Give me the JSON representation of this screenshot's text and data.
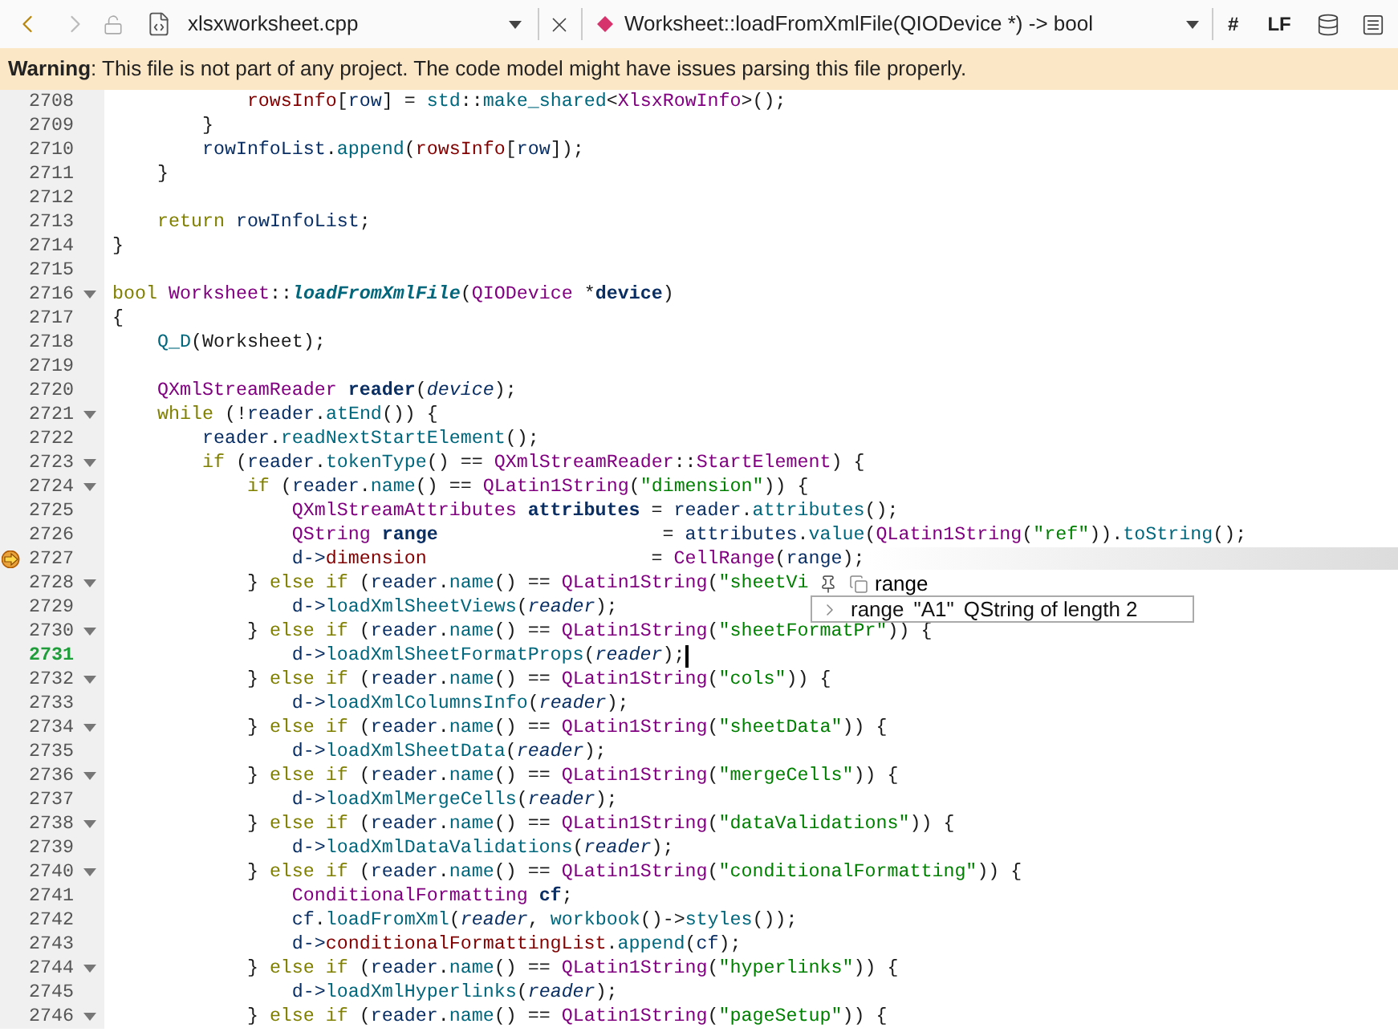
{
  "toolbar": {
    "forward_disabled": true,
    "file_name": "xlsxworksheet.cpp",
    "symbol": "Worksheet::loadFromXmlFile(QIODevice *) -> bool",
    "indent_mark": "#",
    "line_ending": "LF"
  },
  "warning": "**Warning**: This file is not part of any project. The code model might have issues parsing this file properly.",
  "lines": [
    {
      "number": "2708",
      "fold": false,
      "current": false,
      "execution": false,
      "tokens": [
        {
          "kind": "mem",
          "text": "            rowsInfo"
        },
        {
          "kind": "p",
          "text": "["
        },
        {
          "kind": "ns",
          "text": "row"
        },
        {
          "kind": "p",
          "text": "] = "
        },
        {
          "kind": "fn",
          "text": "std"
        },
        {
          "kind": "p",
          "text": "::"
        },
        {
          "kind": "fn",
          "text": "make_shared"
        },
        {
          "kind": "p",
          "text": "<"
        },
        {
          "kind": "ty",
          "text": "XlsxRowInfo"
        },
        {
          "kind": "p",
          "text": ">();"
        }
      ]
    },
    {
      "number": "2709",
      "fold": false,
      "current": false,
      "execution": false,
      "tokens": [
        {
          "kind": "p",
          "text": "        }"
        }
      ]
    },
    {
      "number": "2710",
      "fold": false,
      "current": false,
      "execution": false,
      "tokens": [
        {
          "kind": "ns",
          "text": "        rowInfoList"
        },
        {
          "kind": "p",
          "text": "."
        },
        {
          "kind": "fn",
          "text": "append"
        },
        {
          "kind": "p",
          "text": "("
        },
        {
          "kind": "mem",
          "text": "rowsInfo"
        },
        {
          "kind": "p",
          "text": "["
        },
        {
          "kind": "ns",
          "text": "row"
        },
        {
          "kind": "p",
          "text": "]);"
        }
      ]
    },
    {
      "number": "2711",
      "fold": false,
      "current": false,
      "execution": false,
      "tokens": [
        {
          "kind": "p",
          "text": "    }"
        }
      ]
    },
    {
      "number": "2712",
      "fold": false,
      "current": false,
      "execution": false
    },
    {
      "number": "2713",
      "fold": false,
      "current": false,
      "execution": false,
      "tokens": [
        {
          "kind": "kw",
          "text": "    return "
        },
        {
          "kind": "ns",
          "text": "rowInfoList"
        },
        {
          "kind": "p",
          "text": ";"
        }
      ]
    },
    {
      "number": "2714",
      "fold": false,
      "current": false,
      "execution": false,
      "tokens": [
        {
          "kind": "p",
          "text": "}"
        }
      ]
    },
    {
      "number": "2715",
      "fold": false,
      "current": false,
      "execution": false
    },
    {
      "number": "2716",
      "fold": true,
      "current": false,
      "execution": false,
      "tokens": [
        {
          "kind": "kw",
          "text": "bool "
        },
        {
          "kind": "ty",
          "text": "Worksheet"
        },
        {
          "kind": "p",
          "text": "::"
        },
        {
          "kind": "fd",
          "text": "loadFromXmlFile"
        },
        {
          "kind": "p",
          "text": "("
        },
        {
          "kind": "ty",
          "text": "QIODevice"
        },
        {
          "kind": "p",
          "text": " *"
        },
        {
          "kind": "lv",
          "text": "device"
        },
        {
          "kind": "p",
          "text": ")"
        }
      ]
    },
    {
      "number": "2717",
      "fold": false,
      "current": false,
      "execution": false,
      "tokens": [
        {
          "kind": "p",
          "text": "{"
        }
      ]
    },
    {
      "number": "2718",
      "fold": false,
      "current": false,
      "execution": false,
      "tokens": [
        {
          "kind": "fn",
          "text": "    Q_D"
        },
        {
          "kind": "p",
          "text": "(Worksheet);"
        }
      ]
    },
    {
      "number": "2719",
      "fold": false,
      "current": false,
      "execution": false
    },
    {
      "number": "2720",
      "fold": false,
      "current": false,
      "execution": false,
      "tokens": [
        {
          "kind": "ty",
          "text": "    QXmlStreamReader "
        },
        {
          "kind": "lv",
          "text": "reader"
        },
        {
          "kind": "p",
          "text": "("
        },
        {
          "kind": "it",
          "text": "device"
        },
        {
          "kind": "p",
          "text": ");"
        }
      ]
    },
    {
      "number": "2721",
      "fold": true,
      "current": false,
      "execution": false,
      "tokens": [
        {
          "kind": "kw",
          "text": "    while"
        },
        {
          "kind": "p",
          "text": " (!"
        },
        {
          "kind": "ns",
          "text": "reader"
        },
        {
          "kind": "p",
          "text": "."
        },
        {
          "kind": "fn",
          "text": "atEnd"
        },
        {
          "kind": "p",
          "text": "()) {"
        }
      ]
    },
    {
      "number": "2722",
      "fold": false,
      "current": false,
      "execution": false,
      "tokens": [
        {
          "kind": "ns",
          "text": "        reader"
        },
        {
          "kind": "p",
          "text": "."
        },
        {
          "kind": "fn",
          "text": "readNextStartElement"
        },
        {
          "kind": "p",
          "text": "();"
        }
      ]
    },
    {
      "number": "2723",
      "fold": true,
      "current": false,
      "execution": false,
      "tokens": [
        {
          "kind": "kw",
          "text": "        if"
        },
        {
          "kind": "p",
          "text": " ("
        },
        {
          "kind": "ns",
          "text": "reader"
        },
        {
          "kind": "p",
          "text": "."
        },
        {
          "kind": "fn",
          "text": "tokenType"
        },
        {
          "kind": "p",
          "text": "() == "
        },
        {
          "kind": "ty",
          "text": "QXmlStreamReader"
        },
        {
          "kind": "p",
          "text": "::"
        },
        {
          "kind": "ty",
          "text": "StartElement"
        },
        {
          "kind": "p",
          "text": ") {"
        }
      ]
    },
    {
      "number": "2724",
      "fold": true,
      "current": false,
      "execution": false,
      "tokens": [
        {
          "kind": "kw",
          "text": "            if"
        },
        {
          "kind": "p",
          "text": " ("
        },
        {
          "kind": "ns",
          "text": "reader"
        },
        {
          "kind": "p",
          "text": "."
        },
        {
          "kind": "fn",
          "text": "name"
        },
        {
          "kind": "p",
          "text": "() == "
        },
        {
          "kind": "ty",
          "text": "QLatin1String"
        },
        {
          "kind": "p",
          "text": "("
        },
        {
          "kind": "s",
          "text": "\"dimension\""
        },
        {
          "kind": "p",
          "text": ")) {"
        }
      ]
    },
    {
      "number": "2725",
      "fold": false,
      "current": false,
      "execution": false,
      "tokens": [
        {
          "kind": "ty",
          "text": "                QXmlStreamAttributes "
        },
        {
          "kind": "lv",
          "text": "attributes"
        },
        {
          "kind": "p",
          "text": " = "
        },
        {
          "kind": "ns",
          "text": "reader"
        },
        {
          "kind": "p",
          "text": "."
        },
        {
          "kind": "fn",
          "text": "attributes"
        },
        {
          "kind": "p",
          "text": "();"
        }
      ]
    },
    {
      "number": "2726",
      "fold": false,
      "current": false,
      "execution": false,
      "tokens": [
        {
          "kind": "ty",
          "text": "                QString "
        },
        {
          "kind": "lv",
          "text": "range"
        },
        {
          "kind": "p",
          "text": "                    = "
        },
        {
          "kind": "ns",
          "text": "attributes"
        },
        {
          "kind": "p",
          "text": "."
        },
        {
          "kind": "fn",
          "text": "value"
        },
        {
          "kind": "p",
          "text": "("
        },
        {
          "kind": "ty",
          "text": "QLatin1String"
        },
        {
          "kind": "p",
          "text": "("
        },
        {
          "kind": "s",
          "text": "\"ref\""
        },
        {
          "kind": "p",
          "text": "))."
        },
        {
          "kind": "fn",
          "text": "toString"
        },
        {
          "kind": "p",
          "text": "();"
        }
      ]
    },
    {
      "number": "2727",
      "fold": false,
      "current": false,
      "execution": true,
      "tokens": [
        {
          "kind": "ns",
          "text": "                d->"
        },
        {
          "kind": "mem",
          "text": "dimension"
        },
        {
          "kind": "p",
          "text": "                    = "
        },
        {
          "kind": "ty",
          "text": "CellRange"
        },
        {
          "kind": "p",
          "text": "("
        },
        {
          "kind": "ns",
          "text": "range"
        },
        {
          "kind": "p",
          "text": ");"
        }
      ]
    },
    {
      "number": "2728",
      "fold": true,
      "current": false,
      "execution": false,
      "tokens": [
        {
          "kind": "p",
          "text": "            } "
        },
        {
          "kind": "kw",
          "text": "else if"
        },
        {
          "kind": "p",
          "text": " ("
        },
        {
          "kind": "ns",
          "text": "reader"
        },
        {
          "kind": "p",
          "text": "."
        },
        {
          "kind": "fn",
          "text": "name"
        },
        {
          "kind": "p",
          "text": "() == "
        },
        {
          "kind": "ty",
          "text": "QLatin1String"
        },
        {
          "kind": "p",
          "text": "("
        },
        {
          "kind": "s",
          "text": "\"sheetVi"
        }
      ]
    },
    {
      "number": "2729",
      "fold": false,
      "current": false,
      "execution": false,
      "tokens": [
        {
          "kind": "ns",
          "text": "                d->"
        },
        {
          "kind": "fn",
          "text": "loadXmlSheetViews"
        },
        {
          "kind": "p",
          "text": "("
        },
        {
          "kind": "it",
          "text": "reader"
        },
        {
          "kind": "p",
          "text": ");"
        }
      ]
    },
    {
      "number": "2730",
      "fold": true,
      "current": false,
      "execution": false,
      "tokens": [
        {
          "kind": "p",
          "text": "            } "
        },
        {
          "kind": "kw",
          "text": "else if"
        },
        {
          "kind": "p",
          "text": " ("
        },
        {
          "kind": "ns",
          "text": "reader"
        },
        {
          "kind": "p",
          "text": "."
        },
        {
          "kind": "fn",
          "text": "name"
        },
        {
          "kind": "p",
          "text": "() == "
        },
        {
          "kind": "ty",
          "text": "QLatin1String"
        },
        {
          "kind": "p",
          "text": "("
        },
        {
          "kind": "s",
          "text": "\"sheetFormatPr\""
        },
        {
          "kind": "p",
          "text": ")) {"
        }
      ]
    },
    {
      "number": "2731",
      "fold": false,
      "current": true,
      "execution": false,
      "tokens": [
        {
          "kind": "ns",
          "text": "                d->"
        },
        {
          "kind": "fn",
          "text": "loadXmlSheetFormatProps"
        },
        {
          "kind": "p",
          "text": "("
        },
        {
          "kind": "it",
          "text": "reader"
        },
        {
          "kind": "p",
          "text": ");"
        }
      ]
    },
    {
      "number": "2732",
      "fold": true,
      "current": false,
      "execution": false,
      "tokens": [
        {
          "kind": "p",
          "text": "            } "
        },
        {
          "kind": "kw",
          "text": "else if"
        },
        {
          "kind": "p",
          "text": " ("
        },
        {
          "kind": "ns",
          "text": "reader"
        },
        {
          "kind": "p",
          "text": "."
        },
        {
          "kind": "fn",
          "text": "name"
        },
        {
          "kind": "p",
          "text": "() == "
        },
        {
          "kind": "ty",
          "text": "QLatin1String"
        },
        {
          "kind": "p",
          "text": "("
        },
        {
          "kind": "s",
          "text": "\"cols\""
        },
        {
          "kind": "p",
          "text": ")) {"
        }
      ]
    },
    {
      "number": "2733",
      "fold": false,
      "current": false,
      "execution": false,
      "tokens": [
        {
          "kind": "ns",
          "text": "                d->"
        },
        {
          "kind": "fn",
          "text": "loadXmlColumnsInfo"
        },
        {
          "kind": "p",
          "text": "("
        },
        {
          "kind": "it",
          "text": "reader"
        },
        {
          "kind": "p",
          "text": ");"
        }
      ]
    },
    {
      "number": "2734",
      "fold": true,
      "current": false,
      "execution": false,
      "tokens": [
        {
          "kind": "p",
          "text": "            } "
        },
        {
          "kind": "kw",
          "text": "else if"
        },
        {
          "kind": "p",
          "text": " ("
        },
        {
          "kind": "ns",
          "text": "reader"
        },
        {
          "kind": "p",
          "text": "."
        },
        {
          "kind": "fn",
          "text": "name"
        },
        {
          "kind": "p",
          "text": "() == "
        },
        {
          "kind": "ty",
          "text": "QLatin1String"
        },
        {
          "kind": "p",
          "text": "("
        },
        {
          "kind": "s",
          "text": "\"sheetData\""
        },
        {
          "kind": "p",
          "text": ")) {"
        }
      ]
    },
    {
      "number": "2735",
      "fold": false,
      "current": false,
      "execution": false,
      "tokens": [
        {
          "kind": "ns",
          "text": "                d->"
        },
        {
          "kind": "fn",
          "text": "loadXmlSheetData"
        },
        {
          "kind": "p",
          "text": "("
        },
        {
          "kind": "it",
          "text": "reader"
        },
        {
          "kind": "p",
          "text": ");"
        }
      ]
    },
    {
      "number": "2736",
      "fold": true,
      "current": false,
      "execution": false,
      "tokens": [
        {
          "kind": "p",
          "text": "            } "
        },
        {
          "kind": "kw",
          "text": "else if"
        },
        {
          "kind": "p",
          "text": " ("
        },
        {
          "kind": "ns",
          "text": "reader"
        },
        {
          "kind": "p",
          "text": "."
        },
        {
          "kind": "fn",
          "text": "name"
        },
        {
          "kind": "p",
          "text": "() == "
        },
        {
          "kind": "ty",
          "text": "QLatin1String"
        },
        {
          "kind": "p",
          "text": "("
        },
        {
          "kind": "s",
          "text": "\"mergeCells\""
        },
        {
          "kind": "p",
          "text": ")) {"
        }
      ]
    },
    {
      "number": "2737",
      "fold": false,
      "current": false,
      "execution": false,
      "tokens": [
        {
          "kind": "ns",
          "text": "                d->"
        },
        {
          "kind": "fn",
          "text": "loadXmlMergeCells"
        },
        {
          "kind": "p",
          "text": "("
        },
        {
          "kind": "it",
          "text": "reader"
        },
        {
          "kind": "p",
          "text": ");"
        }
      ]
    },
    {
      "number": "2738",
      "fold": true,
      "current": false,
      "execution": false,
      "tokens": [
        {
          "kind": "p",
          "text": "            } "
        },
        {
          "kind": "kw",
          "text": "else if"
        },
        {
          "kind": "p",
          "text": " ("
        },
        {
          "kind": "ns",
          "text": "reader"
        },
        {
          "kind": "p",
          "text": "."
        },
        {
          "kind": "fn",
          "text": "name"
        },
        {
          "kind": "p",
          "text": "() == "
        },
        {
          "kind": "ty",
          "text": "QLatin1String"
        },
        {
          "kind": "p",
          "text": "("
        },
        {
          "kind": "s",
          "text": "\"dataValidations\""
        },
        {
          "kind": "p",
          "text": ")) {"
        }
      ]
    },
    {
      "number": "2739",
      "fold": false,
      "current": false,
      "execution": false,
      "tokens": [
        {
          "kind": "ns",
          "text": "                d->"
        },
        {
          "kind": "fn",
          "text": "loadXmlDataValidations"
        },
        {
          "kind": "p",
          "text": "("
        },
        {
          "kind": "it",
          "text": "reader"
        },
        {
          "kind": "p",
          "text": ");"
        }
      ]
    },
    {
      "number": "2740",
      "fold": true,
      "current": false,
      "execution": false,
      "tokens": [
        {
          "kind": "p",
          "text": "            } "
        },
        {
          "kind": "kw",
          "text": "else if"
        },
        {
          "kind": "p",
          "text": " ("
        },
        {
          "kind": "ns",
          "text": "reader"
        },
        {
          "kind": "p",
          "text": "."
        },
        {
          "kind": "fn",
          "text": "name"
        },
        {
          "kind": "p",
          "text": "() == "
        },
        {
          "kind": "ty",
          "text": "QLatin1String"
        },
        {
          "kind": "p",
          "text": "("
        },
        {
          "kind": "s",
          "text": "\"conditionalFormatting\""
        },
        {
          "kind": "p",
          "text": ")) {"
        }
      ]
    },
    {
      "number": "2741",
      "fold": false,
      "current": false,
      "execution": false,
      "tokens": [
        {
          "kind": "ty",
          "text": "                ConditionalFormatting "
        },
        {
          "kind": "lv",
          "text": "cf"
        },
        {
          "kind": "p",
          "text": ";"
        }
      ]
    },
    {
      "number": "2742",
      "fold": false,
      "current": false,
      "execution": false,
      "tokens": [
        {
          "kind": "ns",
          "text": "                cf"
        },
        {
          "kind": "p",
          "text": "."
        },
        {
          "kind": "fn",
          "text": "loadFromXml"
        },
        {
          "kind": "p",
          "text": "("
        },
        {
          "kind": "it",
          "text": "reader"
        },
        {
          "kind": "p",
          "text": ", "
        },
        {
          "kind": "fn",
          "text": "workbook"
        },
        {
          "kind": "p",
          "text": "()->"
        },
        {
          "kind": "fn",
          "text": "styles"
        },
        {
          "kind": "p",
          "text": "());"
        }
      ]
    },
    {
      "number": "2743",
      "fold": false,
      "current": false,
      "execution": false,
      "tokens": [
        {
          "kind": "ns",
          "text": "                d->"
        },
        {
          "kind": "mem",
          "text": "conditionalFormattingList"
        },
        {
          "kind": "p",
          "text": "."
        },
        {
          "kind": "fn",
          "text": "append"
        },
        {
          "kind": "p",
          "text": "("
        },
        {
          "kind": "ns",
          "text": "cf"
        },
        {
          "kind": "p",
          "text": ");"
        }
      ]
    },
    {
      "number": "2744",
      "fold": true,
      "current": false,
      "execution": false,
      "tokens": [
        {
          "kind": "p",
          "text": "            } "
        },
        {
          "kind": "kw",
          "text": "else if"
        },
        {
          "kind": "p",
          "text": " ("
        },
        {
          "kind": "ns",
          "text": "reader"
        },
        {
          "kind": "p",
          "text": "."
        },
        {
          "kind": "fn",
          "text": "name"
        },
        {
          "kind": "p",
          "text": "() == "
        },
        {
          "kind": "ty",
          "text": "QLatin1String"
        },
        {
          "kind": "p",
          "text": "("
        },
        {
          "kind": "s",
          "text": "\"hyperlinks\""
        },
        {
          "kind": "p",
          "text": ")) {"
        }
      ]
    },
    {
      "number": "2745",
      "fold": false,
      "current": false,
      "execution": false,
      "tokens": [
        {
          "kind": "ns",
          "text": "                d->"
        },
        {
          "kind": "fn",
          "text": "loadXmlHyperlinks"
        },
        {
          "kind": "p",
          "text": "("
        },
        {
          "kind": "it",
          "text": "reader"
        },
        {
          "kind": "p",
          "text": ");"
        }
      ]
    },
    {
      "number": "2746",
      "fold": true,
      "current": false,
      "execution": false,
      "tokens": [
        {
          "kind": "p",
          "text": "            } "
        },
        {
          "kind": "kw",
          "text": "else if"
        },
        {
          "kind": "p",
          "text": " ("
        },
        {
          "kind": "ns",
          "text": "reader"
        },
        {
          "kind": "p",
          "text": "."
        },
        {
          "kind": "fn",
          "text": "name"
        },
        {
          "kind": "p",
          "text": "() == "
        },
        {
          "kind": "ty",
          "text": "QLatin1String"
        },
        {
          "kind": "p",
          "text": "("
        },
        {
          "kind": "s",
          "text": "\"pageSetup\""
        },
        {
          "kind": "p",
          "text": ")) {"
        }
      ]
    }
  ],
  "tooltip": {
    "expression": "range",
    "name": "range",
    "value": "\"A1\"",
    "type": "QString of length 2"
  }
}
